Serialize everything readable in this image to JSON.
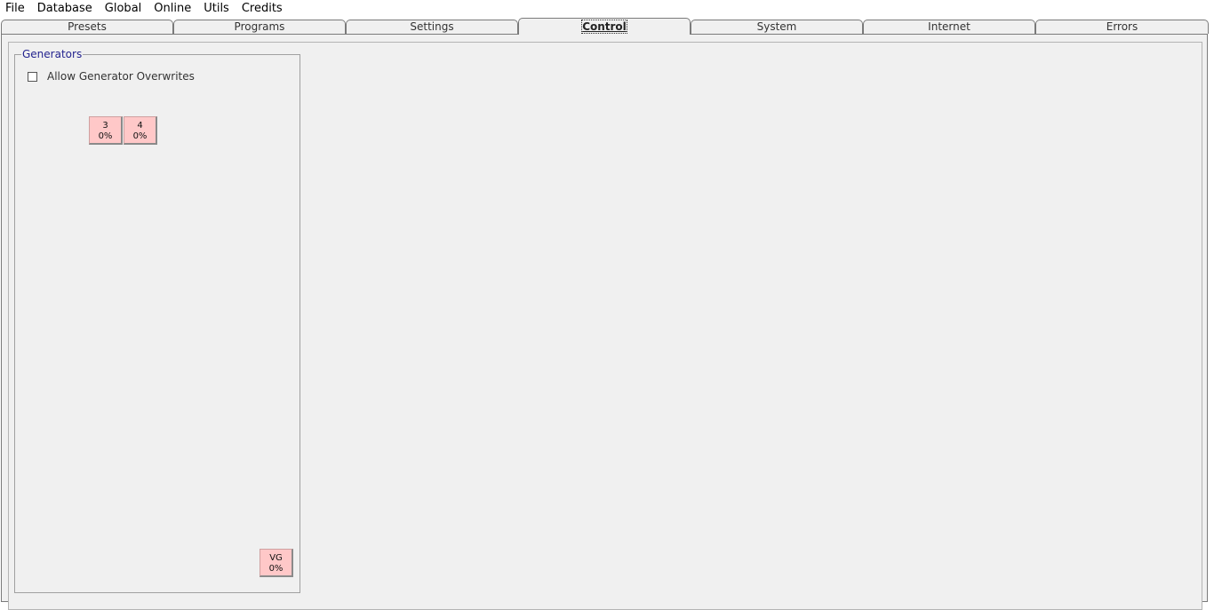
{
  "menu": [
    "File",
    "Database",
    "Global",
    "Online",
    "Utils",
    "Credits"
  ],
  "tabs": [
    {
      "label": "Presets",
      "active": false
    },
    {
      "label": "Programs",
      "active": false
    },
    {
      "label": "Settings",
      "active": false
    },
    {
      "label": "Control",
      "active": true
    },
    {
      "label": "System",
      "active": false
    },
    {
      "label": "Internet",
      "active": false
    },
    {
      "label": "Errors",
      "active": false
    }
  ],
  "generators": {
    "title": "Generators",
    "allow_overwrites_label": "Allow Generator Overwrites",
    "allow_overwrites_checked": false,
    "buttons": [
      {
        "id": "3",
        "percent": "0%"
      },
      {
        "id": "4",
        "percent": "0%"
      }
    ],
    "vg_button": {
      "id": "VG",
      "percent": "0%"
    }
  },
  "colors": {
    "generator_button_bg": "#ffc8c8",
    "groupbox_title": "#23238e",
    "panel_bg": "#f0f0f0"
  }
}
